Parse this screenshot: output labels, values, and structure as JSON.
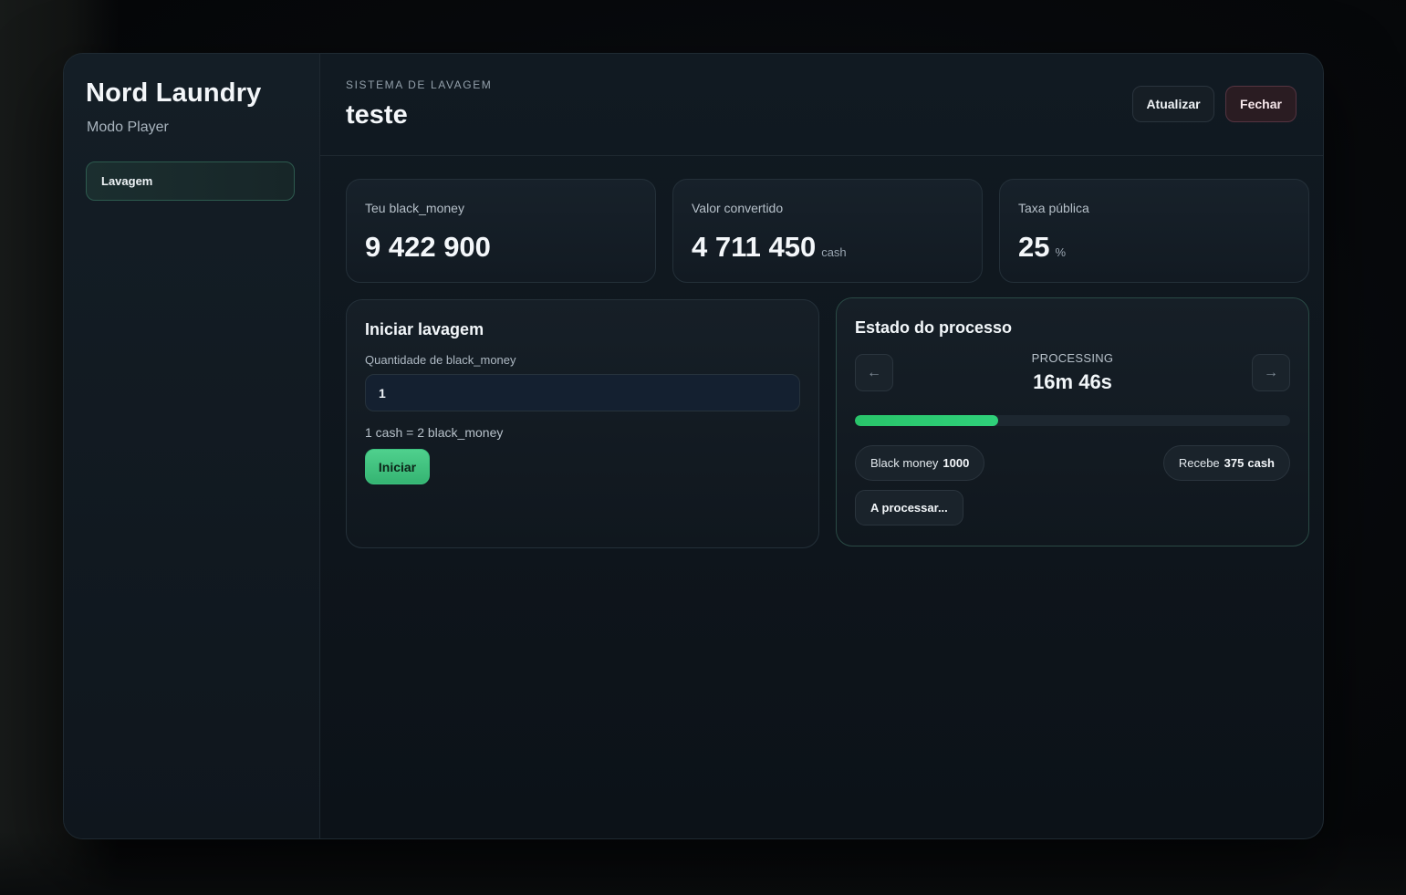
{
  "brand": {
    "title": "Nord Laundry",
    "subtitle": "Modo Player"
  },
  "sidebar": {
    "items": [
      {
        "label": "Lavagem",
        "active": true
      }
    ]
  },
  "header": {
    "eyebrow": "SISTEMA DE LAVAGEM",
    "title": "teste",
    "refresh_label": "Atualizar",
    "close_label": "Fechar"
  },
  "stats": [
    {
      "label": "Teu black_money",
      "value": "9 422 900",
      "unit": ""
    },
    {
      "label": "Valor convertido",
      "value": "4 711 450",
      "unit": "cash"
    },
    {
      "label": "Taxa pública",
      "value": "25",
      "unit": "%"
    }
  ],
  "start_panel": {
    "title": "Iniciar lavagem",
    "field_label": "Quantidade de black_money",
    "input_value": "1",
    "rate_text": "1 cash = 2 black_money",
    "start_label": "Iniciar"
  },
  "status_panel": {
    "title": "Estado do processo",
    "prev_icon": "←",
    "next_icon": "→",
    "status": "PROCESSING",
    "time_left": "16m 46s",
    "progress": 0.33,
    "black_money_label": "Black money",
    "black_money_value": "1000",
    "receive_label": "Recebe",
    "receive_value": "375",
    "receive_unit": "cash",
    "processing_label": "A processar..."
  },
  "colors": {
    "accent_green": "#2fd07a",
    "close_button": "#2a1c22",
    "background": "#0c1218"
  }
}
